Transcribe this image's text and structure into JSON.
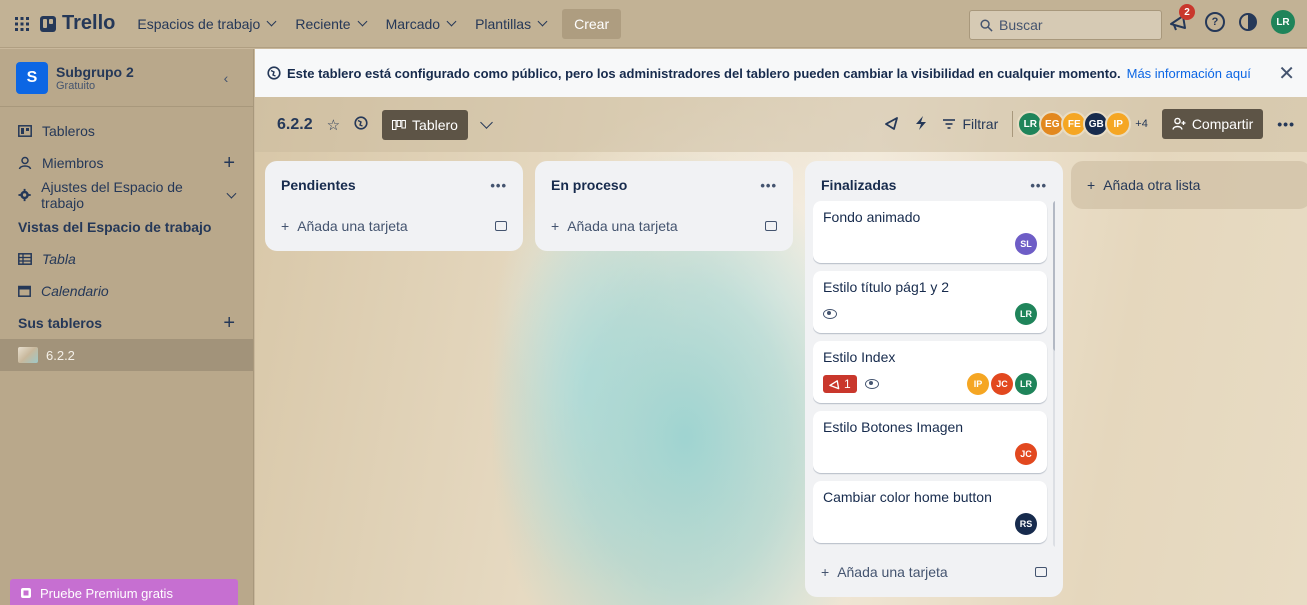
{
  "topbar": {
    "logo": "Trello",
    "nav": [
      {
        "label": "Espacios de trabajo",
        "chevron": true
      },
      {
        "label": "Reciente",
        "chevron": true
      },
      {
        "label": "Marcado",
        "chevron": true
      },
      {
        "label": "Plantillas",
        "chevron": true
      }
    ],
    "create_label": "Crear",
    "search_placeholder": "Buscar",
    "notification_count": "2",
    "help_icon": "?",
    "user_initials": "LR",
    "user_color": "#1f845a"
  },
  "sidebar": {
    "workspace_initial": "S",
    "workspace_name": "Subgrupo 2",
    "workspace_plan": "Gratuito",
    "items": [
      {
        "label": "Tableros",
        "icon": "board-icon"
      },
      {
        "label": "Miembros",
        "icon": "members-icon"
      },
      {
        "label": "Ajustes del Espacio de trabajo",
        "icon": "settings-icon"
      }
    ],
    "views_title": "Vistas del Espacio de trabajo",
    "views": [
      {
        "label": "Tabla",
        "icon": "table-icon"
      },
      {
        "label": "Calendario",
        "icon": "calendar-icon"
      }
    ],
    "boards_title": "Sus tableros",
    "boards": [
      {
        "label": "6.2.2"
      }
    ],
    "premium_label": "Pruebe Premium gratis"
  },
  "banner": {
    "text": "Este tablero está configurado como público, pero los administradores del tablero pueden cambiar la visibilidad en cualquier momento.",
    "link": "Más información aquí",
    "close": "✕"
  },
  "board": {
    "title": "6.2.2",
    "view_label": "Tablero",
    "filter_label": "Filtrar",
    "members": [
      {
        "initials": "LR",
        "color": "#1f845a"
      },
      {
        "initials": "EG",
        "color": "#e2881f"
      },
      {
        "initials": "FE",
        "color": "#f5a623"
      },
      {
        "initials": "GB",
        "color": "#172b4d"
      },
      {
        "initials": "IP",
        "color": "#f5a623"
      }
    ],
    "more_members": "+4",
    "share_label": "Compartir"
  },
  "lists": [
    {
      "title": "Pendientes",
      "add_label": "Añada una tarjeta"
    },
    {
      "title": "En proceso",
      "add_label": "Añada una tarjeta"
    },
    {
      "title": "Finalizadas",
      "add_label": "Añada una tarjeta",
      "cards": [
        {
          "title": "Fondo animado",
          "avatars": [
            {
              "initials": "SL",
              "color": "#6e5dc6"
            }
          ]
        },
        {
          "title": "Estilo título pág1 y 2",
          "watch": true,
          "avatars": [
            {
              "initials": "LR",
              "color": "#1f845a"
            }
          ]
        },
        {
          "title": "Estilo Index",
          "badge": "1",
          "watch": true,
          "avatars": [
            {
              "initials": "IP",
              "color": "#f5a623"
            },
            {
              "initials": "JC",
              "color": "#e2481f"
            },
            {
              "initials": "LR",
              "color": "#1f845a"
            }
          ]
        },
        {
          "title": "Estilo Botones Imagen",
          "avatars": [
            {
              "initials": "JC",
              "color": "#e2481f"
            }
          ]
        },
        {
          "title": "Cambiar color home button",
          "avatars": [
            {
              "initials": "RS",
              "color": "#172b4d"
            }
          ]
        }
      ]
    }
  ],
  "add_list_label": "Añada otra lista"
}
